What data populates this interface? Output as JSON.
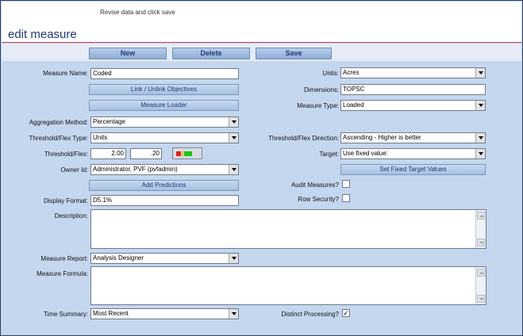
{
  "header": {
    "hint": "Revise data and click save",
    "title": "edit measure"
  },
  "toolbar": {
    "new_label": "New",
    "delete_label": "Delete",
    "save_label": "Save"
  },
  "form": {
    "measure_name": {
      "label": "Measure Name:",
      "value": "Coded"
    },
    "units": {
      "label": "Units:",
      "value": "Acres"
    },
    "link_objectives_label": "Link / Unlink Objectives",
    "dimensions": {
      "label": "Dimensions:",
      "value": "TOPSC"
    },
    "measure_loader_label": "Measure Loader",
    "measure_type": {
      "label": "Measure Type:",
      "value": "Loaded"
    },
    "aggregation_method": {
      "label": "Aggregation Method:",
      "value": "Percentage"
    },
    "threshold_flex_type": {
      "label": "Threshold/Flex Type:",
      "value": "Units"
    },
    "threshold_flex_direction": {
      "label": "Threshold/Flex Direction:",
      "value": "Ascending - Higher is better"
    },
    "threshold_flex": {
      "label": "Threshold/Flex:",
      "value1": "2.00",
      "value2": ".20"
    },
    "target": {
      "label": "Target:",
      "value": "Use fixed value:"
    },
    "owner_id": {
      "label": "Owner Id:",
      "value": "Administrator, PVF (pvfadmin)"
    },
    "set_fixed_target_label": "Set Fixed Target Values",
    "add_predictions_label": "Add Predictions",
    "audit_measures": {
      "label": "Audit Measures?",
      "checked": false
    },
    "display_format": {
      "label": "Display Format:",
      "value": "D5.1%"
    },
    "row_security": {
      "label": "Row Security?",
      "checked": false
    },
    "description": {
      "label": "Description:",
      "value": ""
    },
    "measure_report": {
      "label": "Measure Report:",
      "value": "Analysis Designer"
    },
    "measure_formula": {
      "label": "Measure Formula:",
      "value": ""
    },
    "time_summary": {
      "label": "Time Summary:",
      "value": "Most Recent"
    },
    "distinct_processing": {
      "label": "Distinct Processing?",
      "checked": true,
      "mark": "✓"
    }
  },
  "colors": {
    "title": "#1f3a7a",
    "panel": "#c5d7ef",
    "header_rule": "#c83a4a"
  }
}
